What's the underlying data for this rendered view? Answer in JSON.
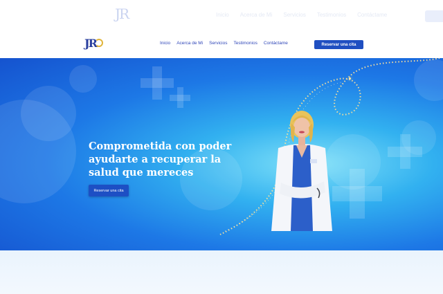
{
  "ghost_header": {
    "logo": "JR",
    "nav": [
      "Inicio",
      "Acerca de Mi",
      "Servicios",
      "Testimonios",
      "Contáctame"
    ]
  },
  "header": {
    "logo": "JR",
    "nav": [
      "Inicio",
      "Acerca de Mi",
      "Servicios",
      "Testimonios",
      "Contáctame"
    ],
    "cta": "Reservar una cita"
  },
  "hero": {
    "title": "Comprometida con poder ayudarte a recuperar la salud que mereces",
    "button": "Reservar una cita"
  },
  "colors": {
    "accent": "#1f4fc1",
    "hero_blue": "#1d78e6",
    "hero_light": "#7fe0f8",
    "gold": "#e0b43a"
  }
}
